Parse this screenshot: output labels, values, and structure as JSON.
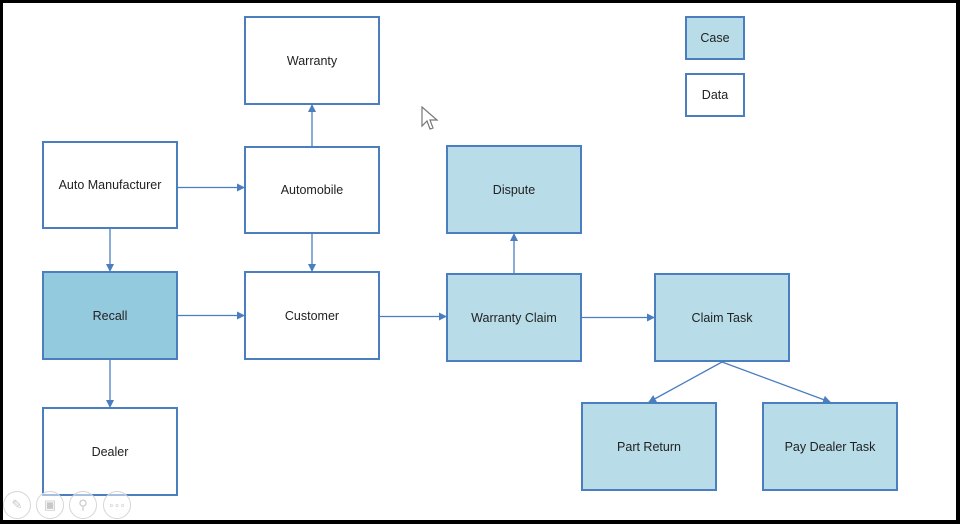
{
  "diagram": {
    "nodes": [
      {
        "id": "warranty",
        "label": "Warranty",
        "type": "data"
      },
      {
        "id": "auto-manufacturer",
        "label": "Auto Manufacturer",
        "type": "data"
      },
      {
        "id": "automobile",
        "label": "Automobile",
        "type": "data"
      },
      {
        "id": "recall",
        "label": "Recall",
        "type": "case"
      },
      {
        "id": "customer",
        "label": "Customer",
        "type": "data"
      },
      {
        "id": "dealer",
        "label": "Dealer",
        "type": "data"
      },
      {
        "id": "dispute",
        "label": "Dispute",
        "type": "case"
      },
      {
        "id": "warranty-claim",
        "label": "Warranty Claim",
        "type": "case"
      },
      {
        "id": "claim-task",
        "label": "Claim Task",
        "type": "case"
      },
      {
        "id": "part-return",
        "label": "Part Return",
        "type": "case"
      },
      {
        "id": "pay-dealer-task",
        "label": "Pay Dealer Task",
        "type": "case"
      }
    ],
    "edges": [
      {
        "from": "auto-manufacturer",
        "to": "automobile"
      },
      {
        "from": "automobile",
        "to": "warranty"
      },
      {
        "from": "auto-manufacturer",
        "to": "recall"
      },
      {
        "from": "automobile",
        "to": "customer"
      },
      {
        "from": "recall",
        "to": "customer"
      },
      {
        "from": "recall",
        "to": "dealer"
      },
      {
        "from": "customer",
        "to": "warranty-claim"
      },
      {
        "from": "warranty-claim",
        "to": "dispute"
      },
      {
        "from": "warranty-claim",
        "to": "claim-task"
      },
      {
        "from": "claim-task",
        "to": "part-return"
      },
      {
        "from": "claim-task",
        "to": "pay-dealer-task"
      }
    ],
    "legend": [
      {
        "label": "Case",
        "type": "case"
      },
      {
        "label": "Data",
        "type": "data"
      }
    ]
  },
  "colors": {
    "border": "#4a7ebf",
    "case_fill": "#b8dde8",
    "recall_fill": "#94cadd",
    "data_fill": "#ffffff"
  },
  "toolbar": [
    {
      "icon": "pen-icon",
      "label": "✎"
    },
    {
      "icon": "slides-icon",
      "label": "▣"
    },
    {
      "icon": "zoom-icon",
      "label": "⚲"
    },
    {
      "icon": "more-icon",
      "label": "∘∘∘"
    }
  ]
}
